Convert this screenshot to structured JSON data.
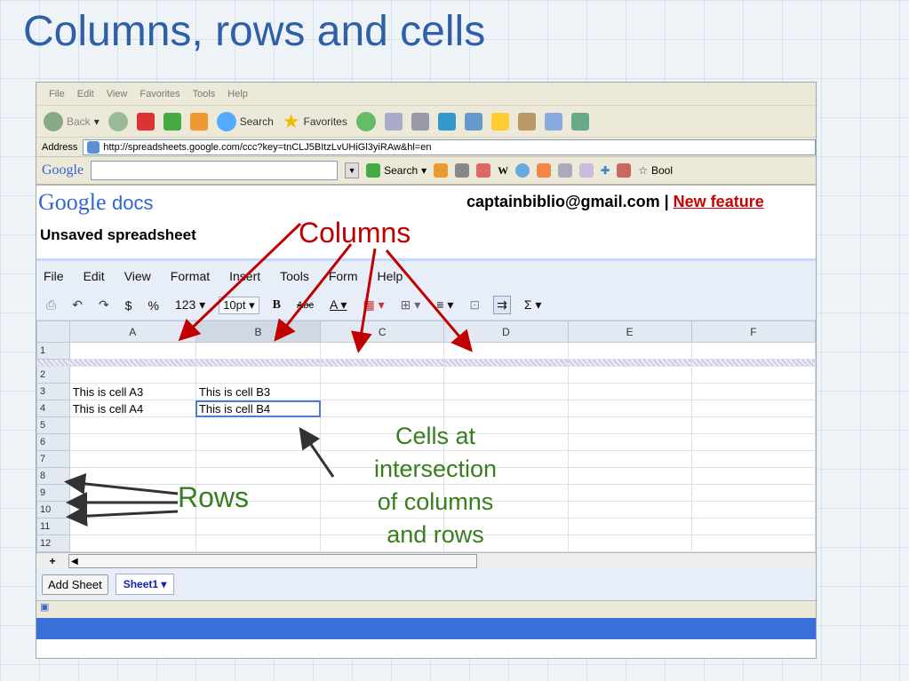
{
  "slide": {
    "title": "Columns, rows and cells"
  },
  "ie": {
    "menu": [
      "File",
      "Edit",
      "View",
      "Favorites",
      "Tools",
      "Help"
    ],
    "toolbar": {
      "back": "Back",
      "search": "Search",
      "favorites": "Favorites"
    },
    "address_label": "Address",
    "url": "http://spreadsheets.google.com/ccc?key=tnCLJ5BItzLvUHiGl3yiRAw&hl=en",
    "google_bar": {
      "logo": "Google",
      "search": "Search",
      "book": "Bool"
    }
  },
  "docs": {
    "logo_google": "Google",
    "logo_docs": "docs",
    "doc_title": "Unsaved spreadsheet",
    "user_email": "captainbiblio@gmail.com",
    "separator": "|",
    "new_features": "New feature"
  },
  "app_menu": [
    "File",
    "Edit",
    "View",
    "Format",
    "Insert",
    "Tools",
    "Form",
    "Help"
  ],
  "app_toolbar": {
    "dollar": "$",
    "percent": "%",
    "number": "123",
    "font_size": "10pt",
    "bold": "B",
    "strike": "Abc",
    "font_color": "A",
    "sigma": "Σ"
  },
  "sheet": {
    "columns": [
      "A",
      "B",
      "C",
      "D",
      "E",
      "F"
    ],
    "rows": [
      {
        "num": "1",
        "cells": [
          "",
          "",
          "",
          "",
          "",
          ""
        ]
      },
      {
        "num": "2",
        "cells": [
          "",
          "",
          "",
          "",
          "",
          ""
        ]
      },
      {
        "num": "3",
        "cells": [
          "This is cell A3",
          "This is cell B3",
          "",
          "",
          "",
          ""
        ]
      },
      {
        "num": "4",
        "cells": [
          "This is cell A4",
          "This is cell B4",
          "",
          "",
          "",
          ""
        ]
      },
      {
        "num": "5",
        "cells": [
          "",
          "",
          "",
          "",
          "",
          ""
        ]
      },
      {
        "num": "6",
        "cells": [
          "",
          "",
          "",
          "",
          "",
          ""
        ]
      },
      {
        "num": "7",
        "cells": [
          "",
          "",
          "",
          "",
          "",
          ""
        ]
      },
      {
        "num": "8",
        "cells": [
          "",
          "",
          "",
          "",
          "",
          ""
        ]
      },
      {
        "num": "9",
        "cells": [
          "",
          "",
          "",
          "",
          "",
          ""
        ]
      },
      {
        "num": "10",
        "cells": [
          "",
          "",
          "",
          "",
          "",
          ""
        ]
      },
      {
        "num": "11",
        "cells": [
          "",
          "",
          "",
          "",
          "",
          ""
        ]
      },
      {
        "num": "12",
        "cells": [
          "",
          "",
          "",
          "",
          "",
          ""
        ]
      }
    ],
    "selected_cell": "B4",
    "add_sheet": "Add Sheet",
    "sheet_tab": "Sheet1 ▾",
    "plus": "+"
  },
  "annotations": {
    "columns": "Columns",
    "rows": "Rows",
    "cells_line1": "Cells at",
    "cells_line2": "intersection",
    "cells_line3": "of columns",
    "cells_line4": "and rows"
  },
  "colors": {
    "title": "#2f5fa7",
    "columns_label": "#c00000",
    "rows_label": "#3a7d1e",
    "arrow_red": "#c00000",
    "arrow_dark": "#333333"
  }
}
